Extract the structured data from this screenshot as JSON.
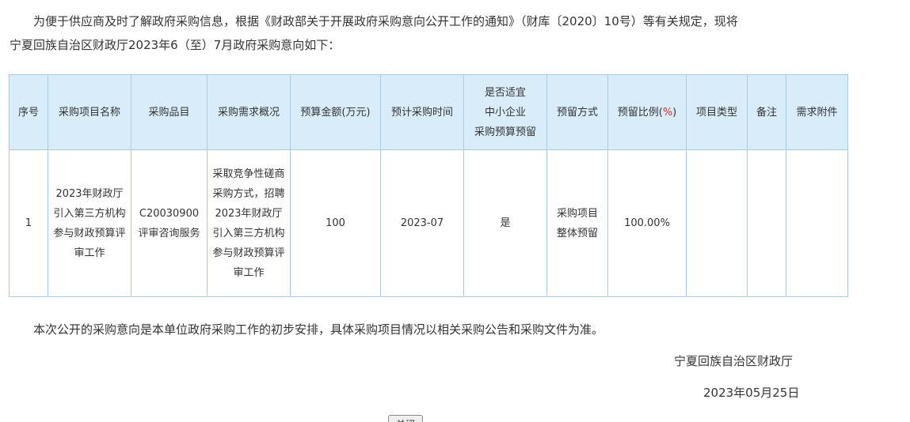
{
  "intro": {
    "line1": "为便于供应商及时了解政府采购信息，根据《财政部关于开展政府采购意向公开工作的通知》（财库〔2020〕10号）等有关规定，现将",
    "line2": "宁夏回族自治区财政厅2023年6（至）7月政府采购意向如下："
  },
  "table": {
    "headers": {
      "seq": "序号",
      "project_name": "采购项目名称",
      "category": "采购品目",
      "overview": "采购需求概况",
      "budget": "预算金额(万元)",
      "time": "预计采购时间",
      "sme_line1": "是否适宜",
      "sme_line2": "中小企业",
      "sme_line3": "采购预算预留",
      "reserve_method": "预留方式",
      "reserve_ratio_prefix": "预留比例(",
      "reserve_ratio_unit": "%",
      "reserve_ratio_suffix": ")",
      "project_type": "项目类型",
      "remark": "备注",
      "attachment": "需求附件"
    },
    "rows": [
      {
        "seq": "1",
        "project_name": "2023年财政厅引入第三方机构参与财政预算评审工作",
        "category": "C20030900评审咨询服务",
        "overview": "采取竞争性磋商采购方式，招聘2023年财政厅引入第三方机构参与财政预算评审工作",
        "budget": "100",
        "time": "2023-07",
        "sme": "是",
        "reserve_method": "采购项目整体预留",
        "reserve_ratio": "100.00%",
        "project_type": "",
        "remark": "",
        "attachment": ""
      }
    ]
  },
  "closing": "本次公开的采购意向是本单位政府采购工作的初步安排，具体采购项目情况以相关采购公告和采购文件为准。",
  "signer": "宁夏回族自治区财政厅",
  "date": "2023年05月25日",
  "close_button": "关闭",
  "colors": {
    "border": "#a8cce6",
    "header_bg": "#d9ecfa",
    "percent_accent": "#e0281c"
  }
}
